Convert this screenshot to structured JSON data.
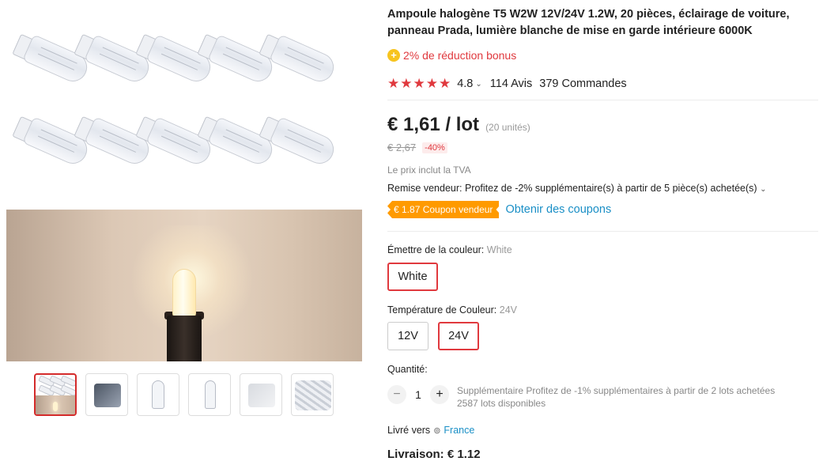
{
  "product": {
    "title": "Ampoule halogène T5 W2W 12V/24V 1.2W, 20 pièces, éclairage de voiture, panneau Prada, lumière blanche de mise en garde intérieure 6000K",
    "bonus": "2% de réduction bonus",
    "rating": {
      "stars": "★★★★★",
      "value": "4.8",
      "reviews": "114 Avis",
      "orders": "379 Commandes"
    }
  },
  "pricing": {
    "price": "€ 1,61 / lot",
    "units": "(20 unités)",
    "old_price": "€ 2,67",
    "discount": "-40%",
    "vat_note": "Le prix inclut la TVA",
    "seller_discount": "Remise vendeur: Profitez de -2% supplémentaire(s) à partir de 5 pièce(s) achetée(s)",
    "coupon": "€ 1.87 Coupon vendeur",
    "get_coupons": "Obtenir des coupons"
  },
  "options": {
    "color_label": "Émettre de la couleur:",
    "color_value": "White",
    "colors": [
      "White"
    ],
    "temp_label": "Température de Couleur:",
    "temp_value": "24V",
    "temps": [
      "12V",
      "24V"
    ]
  },
  "quantity": {
    "label": "Quantité:",
    "minus": "−",
    "value": "1",
    "plus": "+",
    "extra_note": "Supplémentaire Profitez de -1% supplémentaires à partir de 2 lots achetées",
    "stock": "2587 lots disponibles"
  },
  "shipping": {
    "ship_to_label": "Livré vers",
    "country": "France",
    "delivery": "Livraison: € 1.12"
  },
  "colors": {
    "accent": "#e0393e",
    "link": "#1a8fc6",
    "coupon": "#ff9a00",
    "bonus_icon": "#f7c41f"
  }
}
